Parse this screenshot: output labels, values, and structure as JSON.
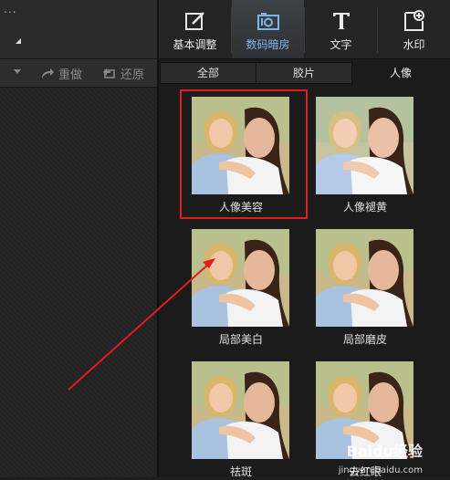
{
  "left": {
    "dots": "...",
    "toolbar": {
      "redo_label": "重做",
      "restore_label": "还原"
    }
  },
  "top_tabs": [
    {
      "label": "基本调整",
      "icon": "adjust-edit-icon"
    },
    {
      "label": "数码暗房",
      "icon": "camera-darkroom-icon",
      "active": true
    },
    {
      "label": "文字",
      "icon": "text-icon"
    },
    {
      "label": "水印",
      "icon": "watermark-icon"
    }
  ],
  "sub_tabs": [
    {
      "label": "全部"
    },
    {
      "label": "胶片"
    },
    {
      "label": "人像",
      "active": true
    }
  ],
  "effects": [
    {
      "caption": "人像美容",
      "selected": true
    },
    {
      "caption": "人像褪黄"
    },
    {
      "caption": "局部美白"
    },
    {
      "caption": "局部磨皮"
    },
    {
      "caption": "祛斑"
    },
    {
      "caption": "去红眼"
    }
  ],
  "watermark": {
    "brand": "Baidu经验",
    "url": "jingyan.baidu.com"
  },
  "colors": {
    "active_tab_text": "#7fb6ea",
    "highlight_border": "#e21b1b",
    "arrow": "#e21b1b"
  }
}
